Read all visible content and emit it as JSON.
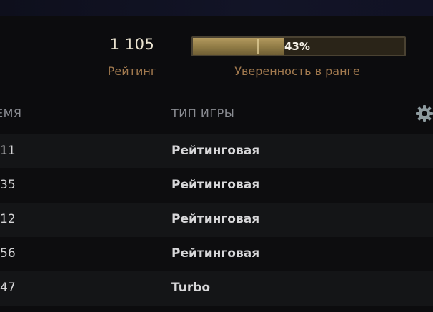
{
  "rating": {
    "value": "1 105",
    "label": "Рейтинг"
  },
  "confidence": {
    "percent_text": "43%",
    "percent": 43,
    "label": "Уверенность в ранге"
  },
  "table": {
    "columns": {
      "time": "ЕМЯ",
      "game_type": "ТИП ИГРЫ"
    },
    "settings_icon": "gear-icon",
    "rows": [
      {
        "time": "11",
        "game_type": "Рейтинговая"
      },
      {
        "time": "35",
        "game_type": "Рейтинговая"
      },
      {
        "time": "12",
        "game_type": "Рейтинговая"
      },
      {
        "time": "56",
        "game_type": "Рейтинговая"
      },
      {
        "time": "47",
        "game_type": "Turbo"
      }
    ]
  },
  "colors": {
    "accent_gold": "#a27a4f",
    "bar_fill": "#8f7a45"
  }
}
